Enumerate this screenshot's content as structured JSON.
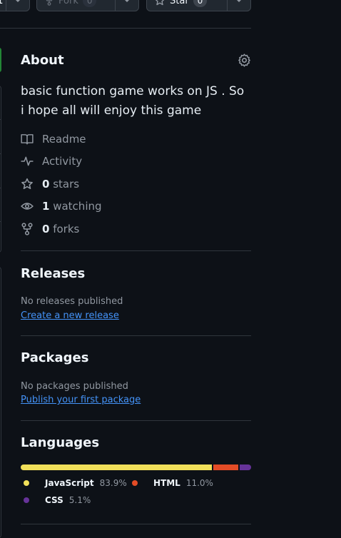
{
  "header": {
    "watch_count": "1",
    "fork_label": "Fork",
    "fork_count": "0",
    "star_label": "Star",
    "star_count": "0"
  },
  "about": {
    "title": "About",
    "description": "basic function game works on JS . So i hope all will enjoy this game",
    "readme": "Readme",
    "activity": "Activity",
    "stars_count": "0",
    "stars_label": "stars",
    "watching_count": "1",
    "watching_label": "watching",
    "forks_count": "0",
    "forks_label": "forks"
  },
  "releases": {
    "title": "Releases",
    "empty": "No releases published",
    "link": "Create a new release"
  },
  "packages": {
    "title": "Packages",
    "empty": "No packages published",
    "link": "Publish your first package"
  },
  "languages": {
    "title": "Languages",
    "items": [
      {
        "name": "JavaScript",
        "percent": "83.9%",
        "value": 83.9,
        "color": "#f1e05a"
      },
      {
        "name": "HTML",
        "percent": "11.0%",
        "value": 11.0,
        "color": "#e34c26"
      },
      {
        "name": "CSS",
        "percent": "5.1%",
        "value": 5.1,
        "color": "#663399"
      }
    ]
  },
  "colors": {
    "background": "#0d1117",
    "border": "#30363d",
    "link": "#4493f8",
    "active_indicator": "#238636"
  }
}
